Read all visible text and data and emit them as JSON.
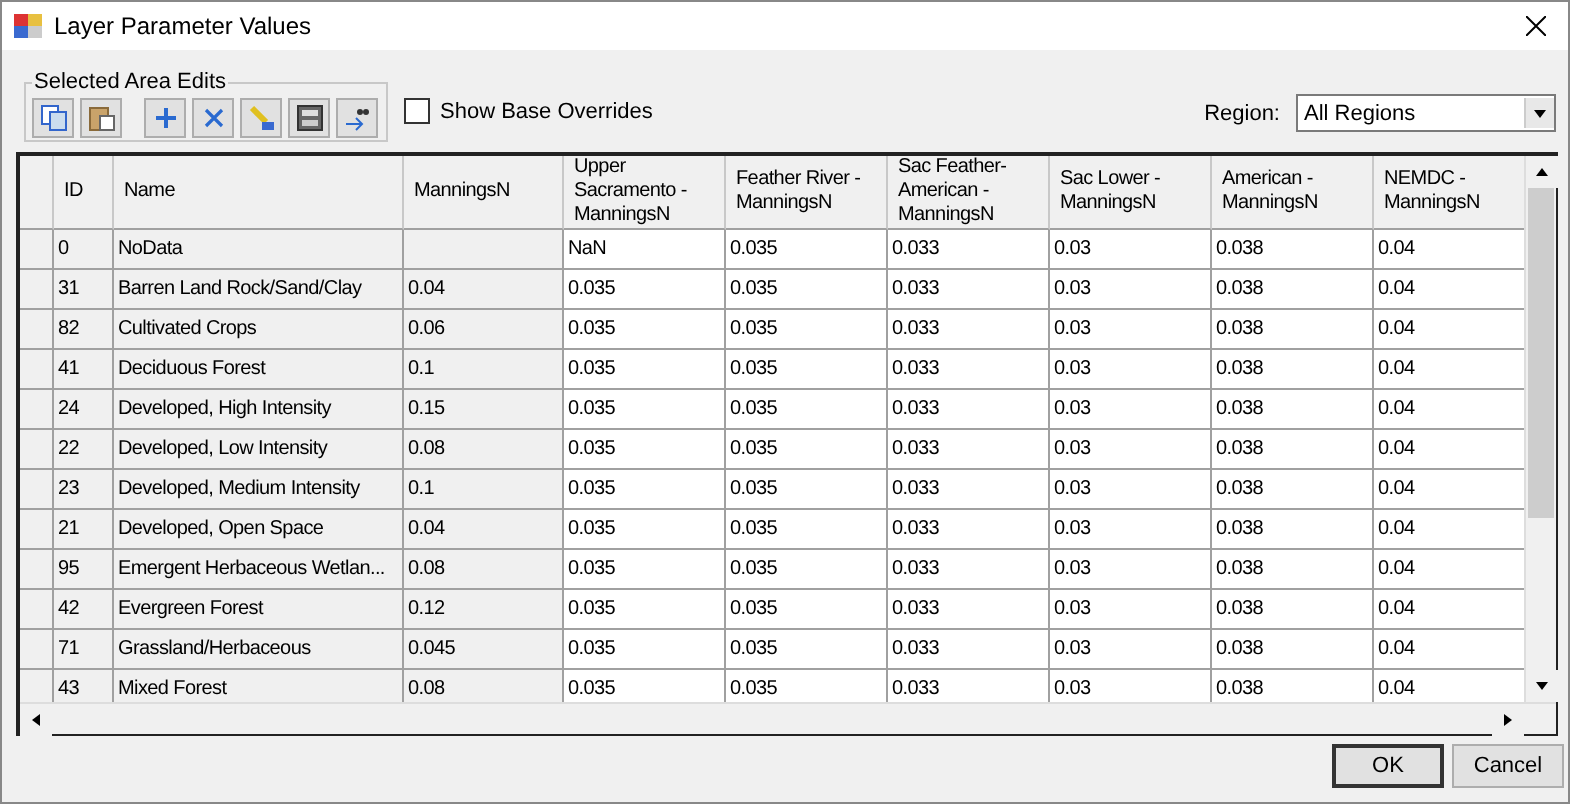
{
  "window": {
    "title": "Layer Parameter Values"
  },
  "toolbar": {
    "group_title": "Selected Area Edits",
    "buttons": [
      {
        "kind": "copy"
      },
      {
        "kind": "paste"
      },
      {
        "kind": "add"
      },
      {
        "kind": "delete"
      },
      {
        "kind": "pencil"
      },
      {
        "kind": "calculator"
      },
      {
        "kind": "decimal"
      }
    ],
    "show_base_overrides": {
      "label": "Show Base Overrides",
      "checked": false
    }
  },
  "region": {
    "label": "Region:",
    "value": "All Regions"
  },
  "table": {
    "columns": [
      {
        "label": "ID",
        "readonly": true
      },
      {
        "label": "Name",
        "readonly": true
      },
      {
        "label": "ManningsN",
        "readonly": true
      },
      {
        "label": "Upper Sacramento - ManningsN",
        "readonly": false
      },
      {
        "label": "Feather River - ManningsN",
        "readonly": false
      },
      {
        "label": "Sac Feather-American - ManningsN",
        "readonly": false
      },
      {
        "label": "Sac Lower - ManningsN",
        "readonly": false
      },
      {
        "label": "American - ManningsN",
        "readonly": false
      },
      {
        "label": "NEMDC - ManningsN",
        "readonly": false
      }
    ],
    "rows": [
      [
        "0",
        "NoData",
        "",
        "NaN",
        "0.035",
        "0.033",
        "0.03",
        "0.038",
        "0.04"
      ],
      [
        "31",
        "Barren Land Rock/Sand/Clay",
        "0.04",
        "0.035",
        "0.035",
        "0.033",
        "0.03",
        "0.038",
        "0.04"
      ],
      [
        "82",
        "Cultivated Crops",
        "0.06",
        "0.035",
        "0.035",
        "0.033",
        "0.03",
        "0.038",
        "0.04"
      ],
      [
        "41",
        "Deciduous Forest",
        "0.1",
        "0.035",
        "0.035",
        "0.033",
        "0.03",
        "0.038",
        "0.04"
      ],
      [
        "24",
        "Developed, High Intensity",
        "0.15",
        "0.035",
        "0.035",
        "0.033",
        "0.03",
        "0.038",
        "0.04"
      ],
      [
        "22",
        "Developed, Low Intensity",
        "0.08",
        "0.035",
        "0.035",
        "0.033",
        "0.03",
        "0.038",
        "0.04"
      ],
      [
        "23",
        "Developed, Medium Intensity",
        "0.1",
        "0.035",
        "0.035",
        "0.033",
        "0.03",
        "0.038",
        "0.04"
      ],
      [
        "21",
        "Developed, Open Space",
        "0.04",
        "0.035",
        "0.035",
        "0.033",
        "0.03",
        "0.038",
        "0.04"
      ],
      [
        "95",
        "Emergent Herbaceous Wetlan...",
        "0.08",
        "0.035",
        "0.035",
        "0.033",
        "0.03",
        "0.038",
        "0.04"
      ],
      [
        "42",
        "Evergreen Forest",
        "0.12",
        "0.035",
        "0.035",
        "0.033",
        "0.03",
        "0.038",
        "0.04"
      ],
      [
        "71",
        "Grassland/Herbaceous",
        "0.045",
        "0.035",
        "0.035",
        "0.033",
        "0.03",
        "0.038",
        "0.04"
      ],
      [
        "43",
        "Mixed Forest",
        "0.08",
        "0.035",
        "0.035",
        "0.033",
        "0.03",
        "0.038",
        "0.04"
      ]
    ]
  },
  "buttons": [
    {
      "label": "OK",
      "default": true
    },
    {
      "label": "Cancel",
      "default": false
    }
  ]
}
